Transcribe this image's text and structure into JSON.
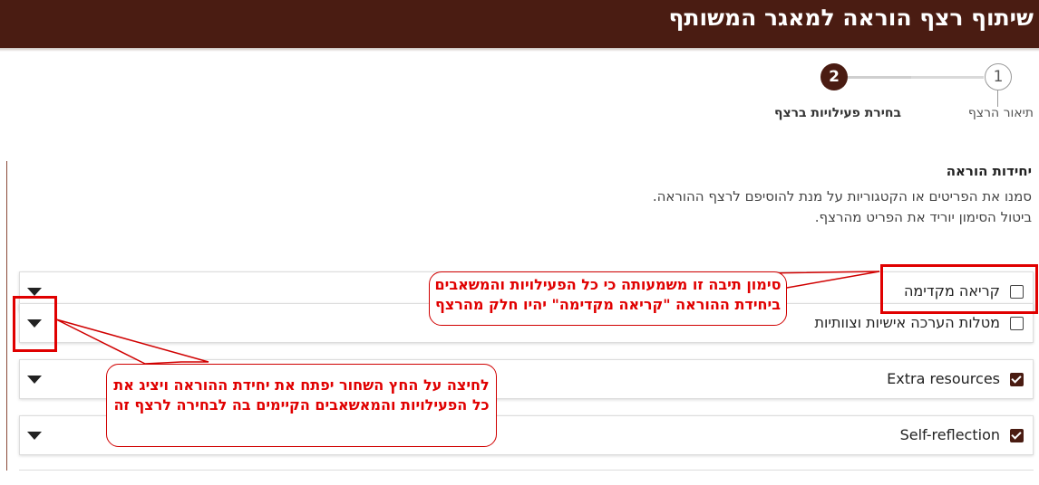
{
  "header": {
    "title": "שיתוף רצף הוראה למאגר המשותף"
  },
  "stepper": {
    "steps": [
      {
        "number": "1",
        "label": "תיאור הרצף",
        "active": false
      },
      {
        "number": "2",
        "label": "בחירת פעילויות ברצף",
        "active": true
      }
    ]
  },
  "section": {
    "title": "יחידות הוראה",
    "instruction_line1": "סמנו את הפריטים או הקטגוריות על מנת להוסיפם לרצף ההוראה.",
    "instruction_line2": "ביטול הסימון יוריד את הפריט מהרצף."
  },
  "accordion": {
    "items": [
      {
        "label": "קריאה מקדימה",
        "checked": false
      },
      {
        "label": "מטלות הערכה אישיות וצוותיות",
        "checked": false
      },
      {
        "label": "Extra resources",
        "checked": true
      },
      {
        "label": "Self-reflection",
        "checked": true
      }
    ]
  },
  "annotations": {
    "checkbox_note": "סימון תיבה זו משמעותה כי כל הפעילויות והמשאבים ביחידת ההוראה \"קריאה מקדימה\" יהיו חלק מהרצף",
    "arrow_note": "לחיצה על החץ השחור יפתח את יחידת ההוראה ויציג את כל הפעילויות והמאשאבים הקיימים בה לבחירה לרצף זה"
  },
  "colors": {
    "brand": "#4a1c12",
    "annotation": "#e00000"
  },
  "icons": {
    "caret": "caret-down-icon",
    "checkbox": "checkbox-icon"
  }
}
